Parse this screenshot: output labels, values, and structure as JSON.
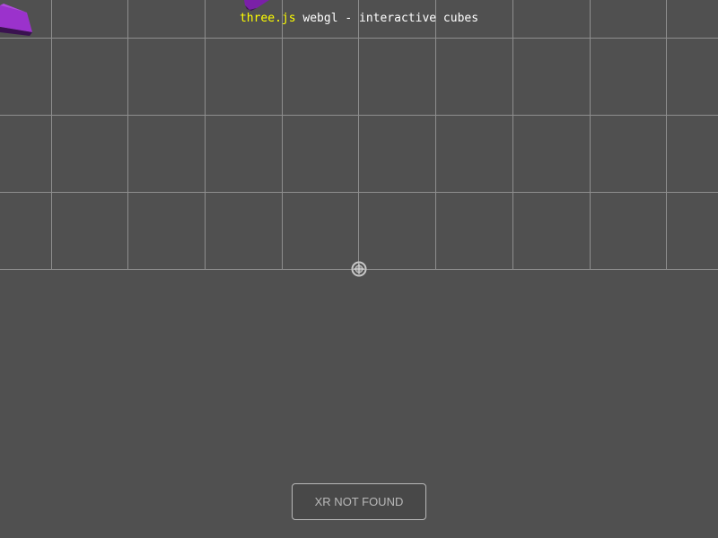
{
  "info": {
    "link_text": "three.js",
    "title_text": " webgl - interactive cubes"
  },
  "xr_button": {
    "label": "XR NOT FOUND"
  },
  "colors": {
    "background": "#505050",
    "grid": "#909090",
    "cube_purple": "#9a30c8",
    "link_yellow": "#ffff00"
  }
}
